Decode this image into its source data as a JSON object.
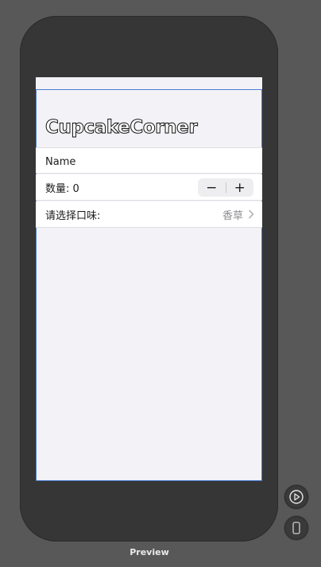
{
  "app": {
    "title": "CupcakeCorner",
    "preview_label": "Preview"
  },
  "form": {
    "name_placeholder": "Name",
    "quantity_label": "数量: 0",
    "stepper_minus": "−",
    "stepper_plus": "+",
    "flavor_label": "请选择口味:",
    "flavor_value": "香草"
  },
  "icons": {
    "play": "play-circle-icon",
    "device": "device-icon",
    "chevron": "chevron-right-icon"
  },
  "colors": {
    "accent_border": "#4d7ed1",
    "canvas_bg": "#585858",
    "screen_bg": "#f3f2f7"
  }
}
